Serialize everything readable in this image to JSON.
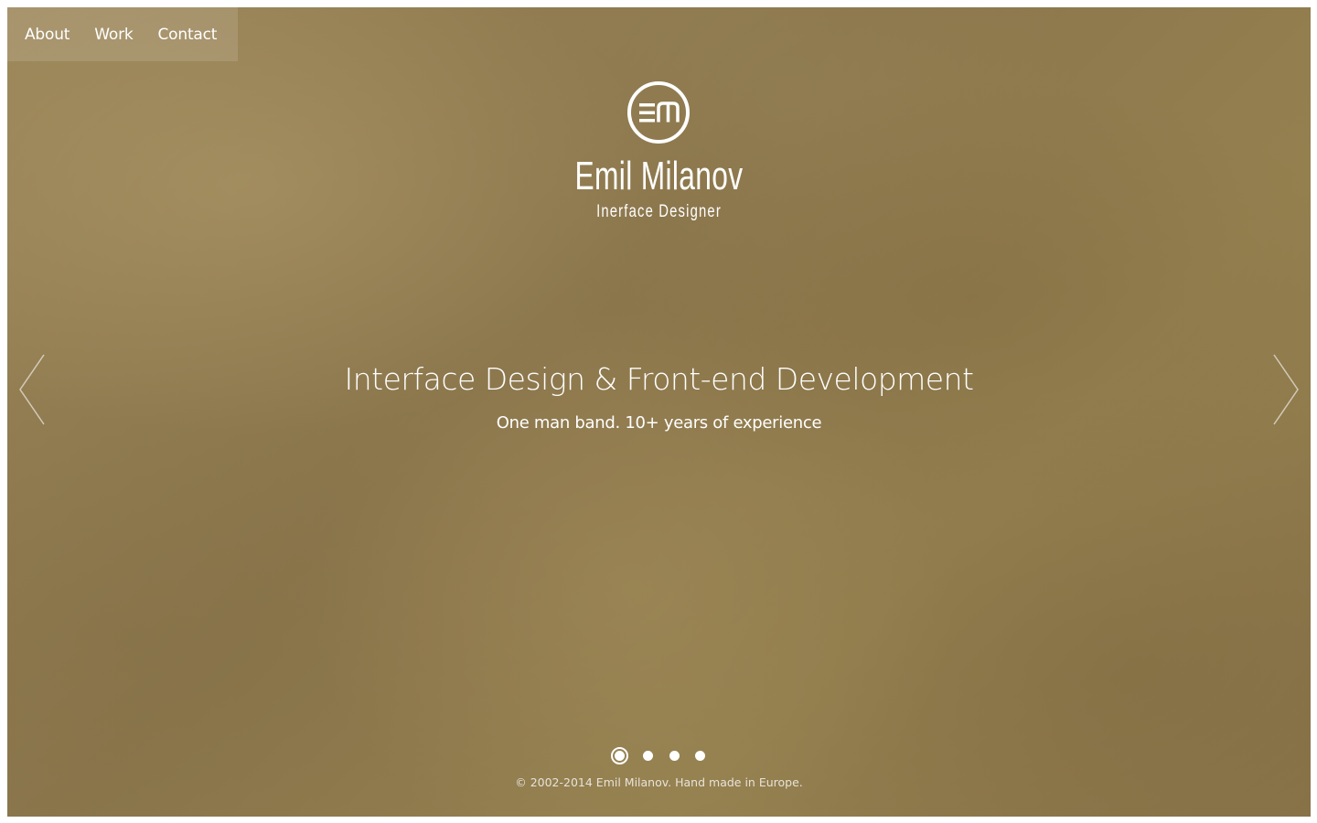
{
  "nav": {
    "items": [
      {
        "label": "About"
      },
      {
        "label": "Work"
      },
      {
        "label": "Contact"
      }
    ]
  },
  "hero": {
    "logo_icon": "em-monogram-icon",
    "name": "Emil Milanov",
    "role": "Inerface Designer"
  },
  "slide": {
    "headline": "Interface Design & Front-end Development",
    "subline": "One man band. 10+ years of experience"
  },
  "carousel": {
    "prev_icon": "chevron-left-icon",
    "next_icon": "chevron-right-icon",
    "slide_count": 4,
    "active_index": 0
  },
  "footer": {
    "text": "© 2002-2014 Emil Milanov. Hand made in Europe."
  },
  "colors": {
    "background": "#8f7a4e",
    "text": "#ffffff"
  }
}
